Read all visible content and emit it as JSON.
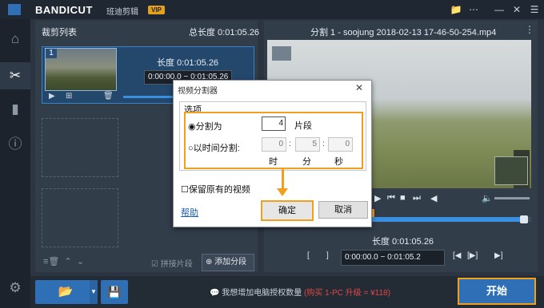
{
  "titlebar": {
    "logo": "BANDICUT",
    "subtitle": "班迪剪辑",
    "vip": "VIP"
  },
  "left": {
    "title": "裁剪列表",
    "total_duration": "总长度 0:01:05.26",
    "clip": {
      "index": "1",
      "duration": "长度 0:01:05.26",
      "range": "0:00:00.0 ~ 0:01:05.26"
    },
    "merge_label": "拼接片段",
    "add_segment_label": "添加分段"
  },
  "right": {
    "filename": "分割 1 - soojung 2018-02-13 17-46-50-254.mp4",
    "duration": "长度 0:01:05.26",
    "range": "0:00:00.0 ~ 0:01:05.2"
  },
  "bottom": {
    "notice_prefix": "我想增加电脑授权数量",
    "notice_highlight": "(购买 1-PC 升级 = ¥118)",
    "start_label": "开始"
  },
  "dialog": {
    "title": "视频分割器",
    "group_label": "选项",
    "option_split_label": "分割为",
    "split_count": "4",
    "split_unit": "片段",
    "option_time_label": "以时间分割:",
    "time_values": [
      "0",
      "5",
      "0"
    ],
    "time_labels": [
      "时",
      "分",
      "秒"
    ],
    "keep_original_label": "保留原有的视频",
    "help_label": "帮助",
    "ok_label": "确定",
    "cancel_label": "取消"
  }
}
